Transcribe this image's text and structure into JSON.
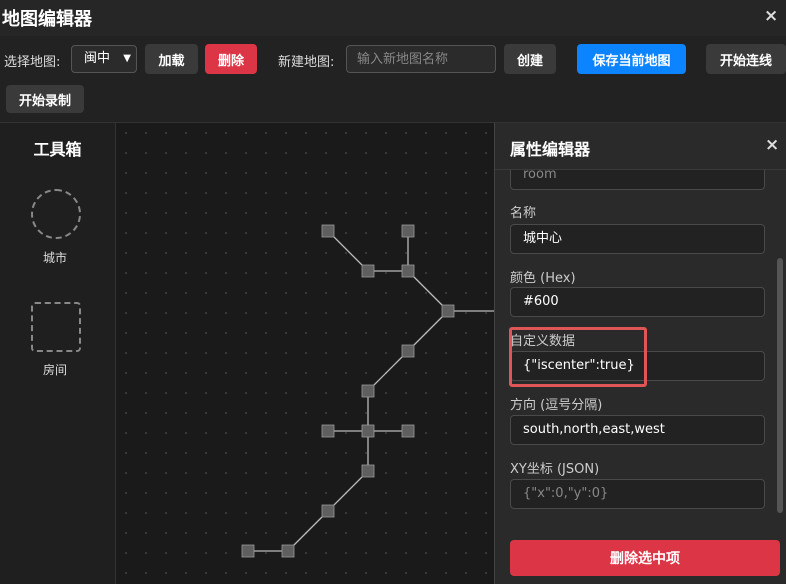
{
  "window": {
    "title": "地图编辑器",
    "close": "×"
  },
  "toolbar": {
    "select_map_label": "选择地图:",
    "selected_map": "闽中",
    "load_button": "加载",
    "delete_button": "删除",
    "new_map_label": "新建地图:",
    "new_map_placeholder": "输入新地图名称",
    "create_button": "创建",
    "save_button": "保存当前地图",
    "start_link_button": "开始连线",
    "start_record_button": "开始录制"
  },
  "toolbox": {
    "title": "工具箱",
    "items": [
      {
        "label": "城市"
      },
      {
        "label": "房间"
      }
    ]
  },
  "properties": {
    "title": "属性编辑器",
    "close": "×",
    "type_value": "room",
    "name_label": "名称",
    "name_value": "城中心",
    "color_label": "颜色 (Hex)",
    "color_value": "#600",
    "custom_label": "自定义数据",
    "custom_value": "{\"iscenter\":true}",
    "direction_label": "方向 (逗号分隔)",
    "direction_value": "south,north,east,west",
    "xy_label": "XY坐标 (JSON)",
    "xy_placeholder": "{\"x\":0,\"y\":0}",
    "delete_selected_button": "删除选中项"
  },
  "colors": {
    "danger": "#dc3545",
    "primary": "#0d84ff",
    "highlight": "#e05555"
  }
}
